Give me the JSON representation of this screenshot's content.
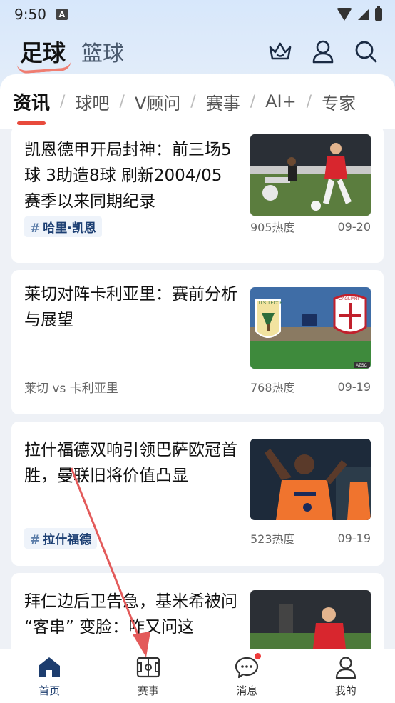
{
  "status": {
    "time": "9:50",
    "notif_letter": "A"
  },
  "header": {
    "sports": [
      {
        "label": "足球"
      },
      {
        "label": "篮球"
      }
    ],
    "icons": [
      "crown-icon",
      "user-icon",
      "search-icon"
    ]
  },
  "tabs": [
    {
      "label": "资讯"
    },
    {
      "label": "球吧"
    },
    {
      "label": "V顾问"
    },
    {
      "label": "赛事"
    },
    {
      "label": "AI+"
    },
    {
      "label": "专家"
    }
  ],
  "articles": [
    {
      "title": "凯恩德甲开局封神：前三场5球 3助造8球 刷新2004/05赛季以来同期纪录",
      "tag": "哈里·凯恩",
      "heat": "905热度",
      "date": "09-20",
      "image": "soccer player in red kit dribbling ball"
    },
    {
      "title": "莱切对阵卡利亚里：赛前分析与展望",
      "subtitle": "莱切 vs 卡利亚里",
      "heat": "768热度",
      "date": "09-19",
      "image": "Lecce and Cagliari crests over stadium",
      "crest_left": "U.S. LECCE",
      "crest_right": "CAGLIARI",
      "corner_text": "AZSC"
    },
    {
      "title": "拉什福德双响引领巴萨欧冠首胜，曼联旧将价值凸显",
      "tag": "拉什福德",
      "heat": "523热度",
      "date": "09-19",
      "image": "player in orange kit celebrating"
    },
    {
      "title": "拜仁边后卫告急，基米希被问 “客串” 变脸：咋又问这",
      "image": "player in red kit kneeling on pitch"
    }
  ],
  "bottom_nav": [
    {
      "label": "首页",
      "icon": "home-icon",
      "active": true
    },
    {
      "label": "赛事",
      "icon": "pitch-icon",
      "active": false
    },
    {
      "label": "消息",
      "icon": "chat-bubble-icon",
      "active": false,
      "badge": true
    },
    {
      "label": "我的",
      "icon": "profile-icon",
      "active": false
    }
  ],
  "colors": {
    "accent_red": "#e84a3c",
    "nav_active": "#1d3d6e",
    "arrow": "#e35a5a"
  }
}
